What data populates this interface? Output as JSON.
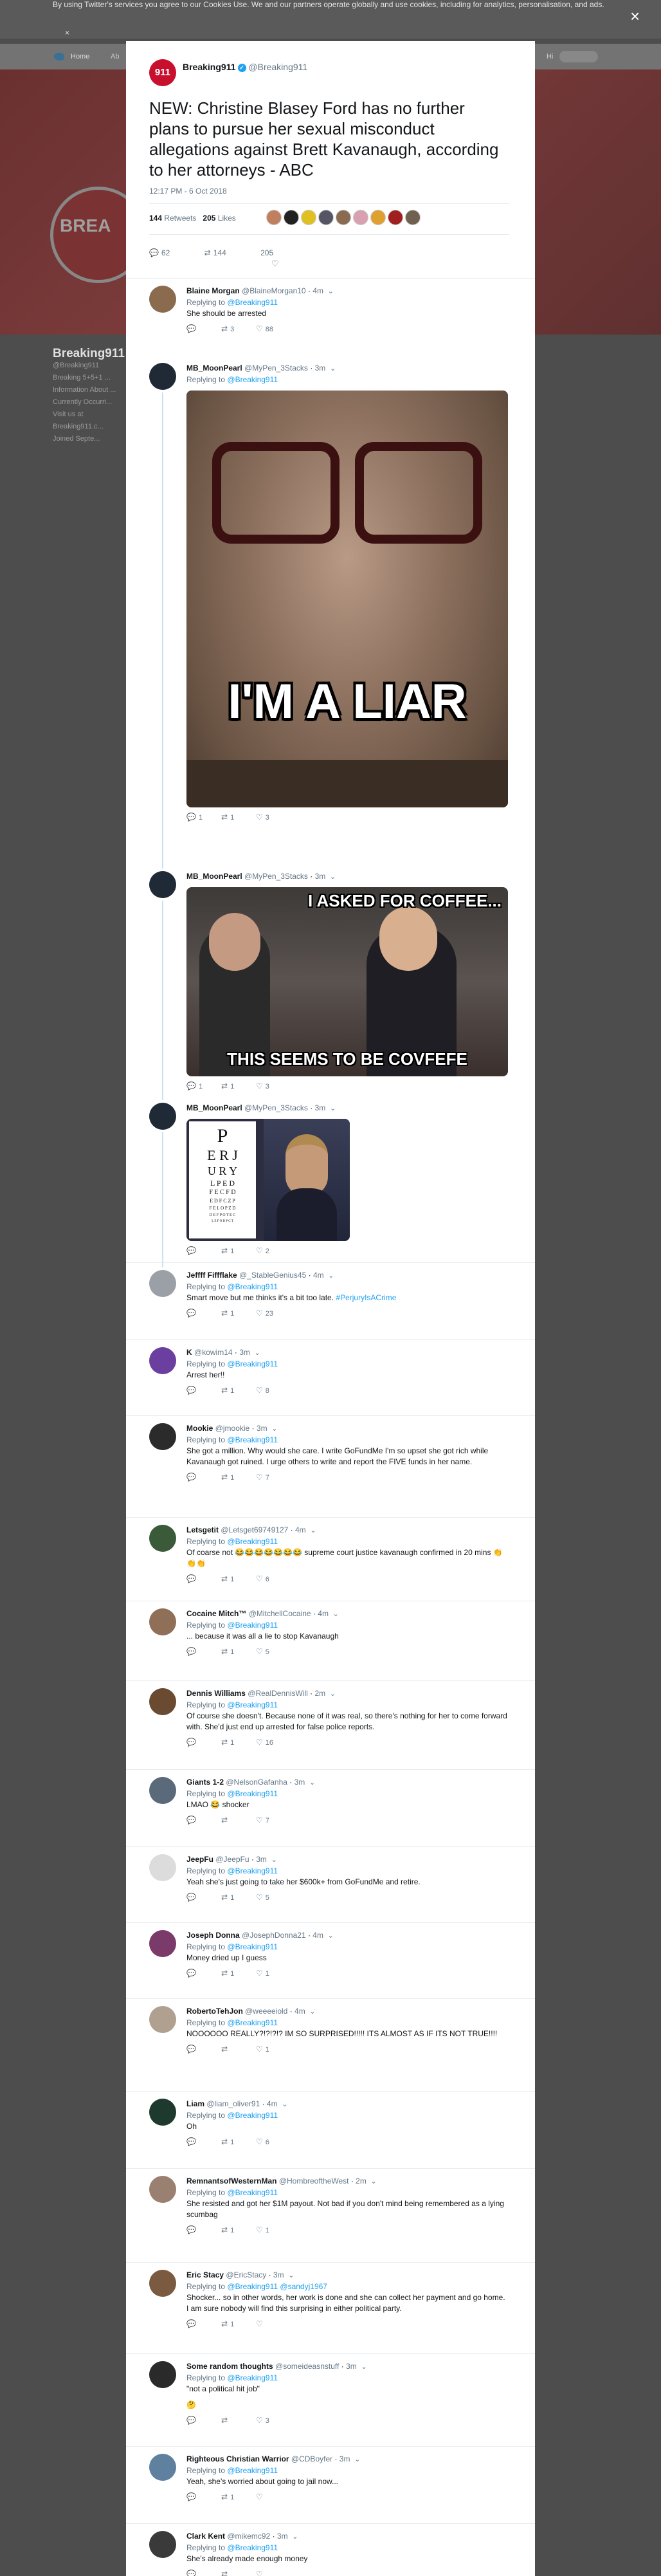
{
  "background": {
    "cookie_text": "By using Twitter's services you agree to our Cookies Use. We and our partners operate globally and use cookies, including for analytics, personalisation, and ads.",
    "cookie_close": "×",
    "nav_home": "Home",
    "nav_alt": "Ab",
    "nav_hi": "Hi",
    "banner_logo_text": "BREA",
    "profile_name": "Breaking911",
    "profile_handle": "@Breaking911",
    "profile_bio": "Breaking 5+5+1 ... Information About ... Currently Occurri...",
    "profile_visit": "Visit us at",
    "profile_link": "Breaking911.c...",
    "profile_joined": "Joined Septe...",
    "modal_close": "×"
  },
  "tweet": {
    "avatar_text": "911",
    "user_name": "Breaking911",
    "handle": "@Breaking911",
    "text": "NEW: Christine Blasey Ford has no further plans to pursue her sexual misconduct allegations against Brett Kavanaugh, according to her attorneys - ABC",
    "timestamp": "12:17 PM - 6 Oct 2018",
    "retweets": "144",
    "retweets_label": "Retweets",
    "likes": "205",
    "likes_label": "Likes",
    "reply_count": "62",
    "retweet_count": "144",
    "like_count": "205"
  },
  "replying_prefix": "Replying to",
  "replies": [
    {
      "name": "Blaine Morgan",
      "handle": "@BlaineMorgan10",
      "time": "4m",
      "reply_to": "@Breaking911",
      "text": "She should be arrested",
      "c_reply": "",
      "c_rt": "3",
      "c_like": "88",
      "avatar": "#8a6b4e"
    },
    {
      "name": "MB_MoonPearl",
      "handle": "@MyPen_3Stacks",
      "time": "3m",
      "reply_to": "@Breaking911",
      "text": "",
      "meme": "I'M A LIAR",
      "c_reply": "1",
      "c_rt": "1",
      "c_like": "3",
      "avatar": "#1f2a36"
    },
    {
      "name": "MB_MoonPearl",
      "handle": "@MyPen_3Stacks",
      "time": "3m",
      "reply_to": "",
      "text": "",
      "meme_top": "I ASKED FOR COFFEE...",
      "meme_bottom": "THIS SEEMS TO BE COVFEFE",
      "c_reply": "1",
      "c_rt": "1",
      "c_like": "3",
      "avatar": "#1f2a36"
    },
    {
      "name": "MB_MoonPearl",
      "handle": "@MyPen_3Stacks",
      "time": "3m",
      "reply_to": "",
      "text": "",
      "chart_lines": [
        "P",
        "E R J",
        "U R Y",
        "L P E D",
        "F E C F D",
        "E D F C Z P",
        "F E L O P Z D",
        "D E F P O T E C",
        "L E F O D P C T"
      ],
      "c_reply": "",
      "c_rt": "1",
      "c_like": "2",
      "avatar": "#1f2a36"
    },
    {
      "name": "Jeffff Fiffflake",
      "handle": "@_StableGenius45",
      "time": "4m",
      "reply_to": "@Breaking911",
      "text": "Smart move but me thinks it's a bit too late. ",
      "tag": "#PerjuryIsACrime",
      "c_reply": "",
      "c_rt": "1",
      "c_like": "23",
      "avatar": "#9aa0a6"
    },
    {
      "name": "K",
      "handle": "@kowim14",
      "time": "3m",
      "reply_to": "@Breaking911",
      "text": "Arrest her!!",
      "c_reply": "",
      "c_rt": "1",
      "c_like": "8",
      "avatar": "#6b3fa0"
    },
    {
      "name": "Mookie",
      "handle": "@jmookie",
      "time": "3m",
      "reply_to": "@Breaking911",
      "text": "She got a million. Why would she care. I write GoFundMe I'm so upset she got rich while Kavanaugh got ruined. I urge others to write and report the FIVE funds in her name.",
      "c_reply": "",
      "c_rt": "1",
      "c_like": "7",
      "avatar": "#2b2b2b"
    },
    {
      "name": "Letsgetit",
      "handle": "@Letsget69749127",
      "time": "4m",
      "reply_to": "@Breaking911",
      "text": "Of coarse not 😂😂😂😂😂😂😂 supreme court justice kavanaugh confirmed in 20 mins 👏👏👏",
      "c_reply": "",
      "c_rt": "1",
      "c_like": "6",
      "avatar": "#3a5a3a"
    },
    {
      "name": "Cocaine Mitch™",
      "handle": "@MitchellCocaine",
      "time": "4m",
      "reply_to": "@Breaking911",
      "text": "... because it was all a lie to stop Kavanaugh",
      "c_reply": "",
      "c_rt": "1",
      "c_like": "5",
      "avatar": "#8f6f58"
    },
    {
      "name": "Dennis Williams",
      "handle": "@RealDennisWill",
      "time": "2m",
      "reply_to": "@Breaking911",
      "text": "Of course she doesn't. Because none of it was real, so there's nothing for her to come forward with. She'd just end up arrested for false police reports.",
      "c_reply": "",
      "c_rt": "1",
      "c_like": "16",
      "avatar": "#6a4a30"
    },
    {
      "name": "Giants 1-2",
      "handle": "@NelsonGafanha",
      "time": "3m",
      "reply_to": "@Breaking911",
      "text": "LMAO 😂 shocker",
      "c_reply": "",
      "c_rt": "",
      "c_like": "7",
      "avatar": "#5a6a7a"
    },
    {
      "name": "JeepFu",
      "handle": "@JeepFu",
      "time": "3m",
      "reply_to": "@Breaking911",
      "text": "Yeah she's just going to take her $600k+ from GoFundMe and retire.",
      "c_reply": "",
      "c_rt": "1",
      "c_like": "5",
      "avatar": "#dcdcdc"
    },
    {
      "name": "Joseph Donna",
      "handle": "@JosephDonna21",
      "time": "4m",
      "reply_to": "@Breaking911",
      "text": "Money dried up I guess",
      "c_reply": "",
      "c_rt": "1",
      "c_like": "1",
      "avatar": "#7a3a6a"
    },
    {
      "name": "RobertoTehJon",
      "handle": "@weeeeiold",
      "time": "4m",
      "reply_to": "@Breaking911",
      "text": "NOOOOOO REALLY?!?!?!? IM SO SURPRISED!!!!! ITS ALMOST AS IF ITS NOT TRUE!!!!",
      "c_reply": "",
      "c_rt": "",
      "c_like": "1",
      "avatar": "#b0a090"
    },
    {
      "name": "Liam",
      "handle": "@liam_oliver91",
      "time": "4m",
      "reply_to": "@Breaking911",
      "text": "Oh",
      "c_reply": "",
      "c_rt": "1",
      "c_like": "6",
      "avatar": "#1e3a2e"
    },
    {
      "name": "RemnantsofWesternMan",
      "handle": "@HombreoftheWest",
      "time": "2m",
      "reply_to": "@Breaking911",
      "text": "She resisted and got her $1M payout.  Not bad if you don't mind being remembered as a lying scumbag",
      "c_reply": "",
      "c_rt": "1",
      "c_like": "1",
      "avatar": "#9a8070"
    },
    {
      "name": "Eric Stacy",
      "handle": "@EricStacy",
      "time": "3m",
      "reply_to": "@Breaking911 @sandyj1967",
      "text": "Shocker... so in other words, her work is done and she can collect her payment and go home. I am sure nobody will find this surprising in either political party.",
      "c_reply": "",
      "c_rt": "1",
      "c_like": "",
      "avatar": "#7a5a40"
    },
    {
      "name": "Some random thoughts",
      "handle": "@someideasnstuff",
      "time": "3m",
      "reply_to": "@Breaking911",
      "text": "\"not a political hit job\"",
      "emoji": "🤔",
      "c_reply": "",
      "c_rt": "",
      "c_like": "3",
      "avatar": "#2a2a2a"
    },
    {
      "name": "Righteous Christian Warrior",
      "handle": "@CDBoyfer",
      "time": "3m",
      "reply_to": "@Breaking911",
      "text": "Yeah, she's worried about going to jail now...",
      "c_reply": "",
      "c_rt": "1",
      "c_like": "",
      "avatar": "#6080a0"
    },
    {
      "name": "Clark Kent",
      "handle": "@mikemc92",
      "time": "3m",
      "reply_to": "@Breaking911",
      "text": "She's already made enough money",
      "c_reply": "",
      "c_rt": "",
      "c_like": "",
      "avatar": "#3a3a3a"
    }
  ],
  "colors": {
    "brand": "#c8102e",
    "link": "#1da1f2",
    "muted": "#657786"
  }
}
